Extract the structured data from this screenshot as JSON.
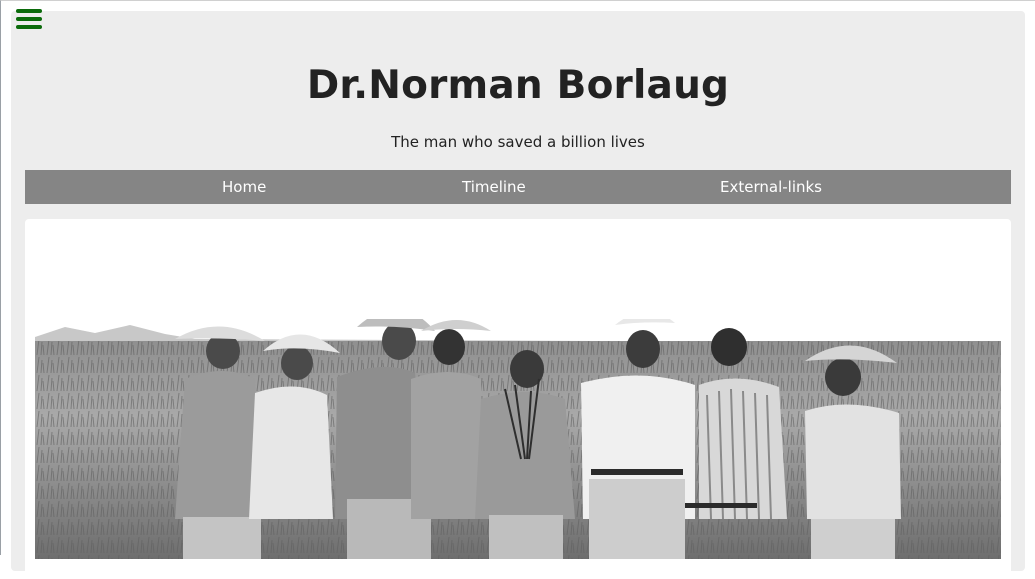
{
  "header": {
    "title": "Dr.Norman Borlaug",
    "subtitle": "The man who saved a billion lives"
  },
  "nav": {
    "items": [
      {
        "label": "Home"
      },
      {
        "label": "Timeline"
      },
      {
        "label": "External-links"
      }
    ]
  },
  "icons": {
    "menu": "hamburger-menu-icon"
  },
  "colors": {
    "menu_icon": "#0b6b0b",
    "container_bg": "#ededed",
    "navbar_bg": "#858585",
    "nav_text": "#ffffff",
    "title_text": "#222222"
  }
}
